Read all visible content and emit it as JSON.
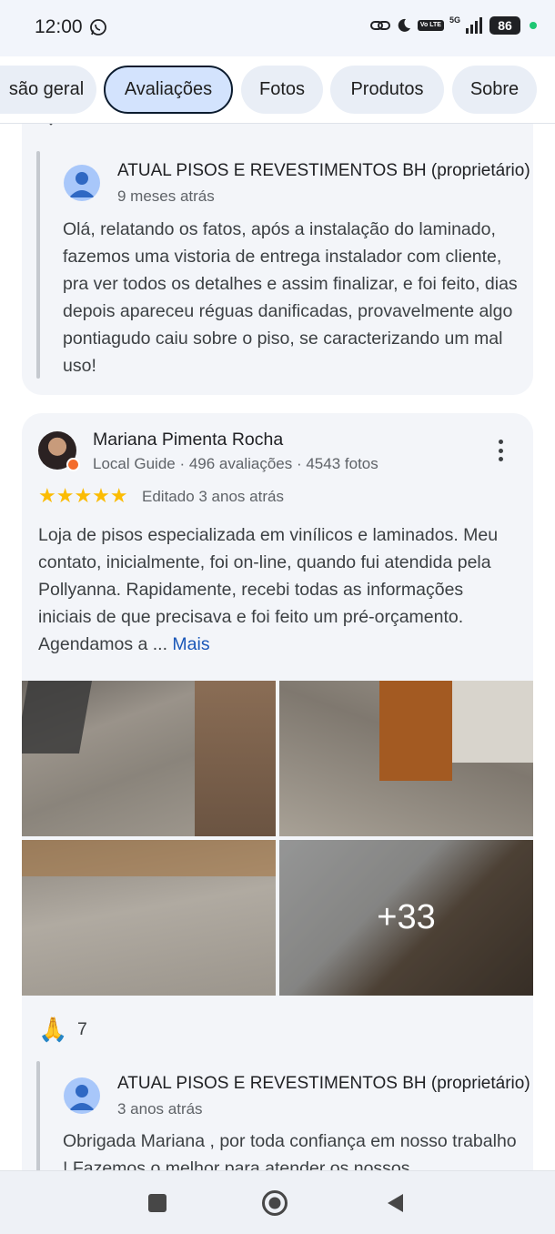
{
  "status": {
    "time": "12:00",
    "network": "5G",
    "volte": "Vo LTE",
    "battery": "86"
  },
  "tabs": [
    {
      "label": "são geral",
      "active": false
    },
    {
      "label": "Avaliações",
      "active": true
    },
    {
      "label": "Fotos",
      "active": false
    },
    {
      "label": "Produtos",
      "active": false
    },
    {
      "label": "Sobre",
      "active": false
    }
  ],
  "replies": [
    {
      "owner_name": "ATUAL PISOS E REVESTIMENTOS BH (proprietário)",
      "time": "9 meses atrás",
      "text": "Olá, relatando os fatos, após a instalação do laminado, fazemos uma vistoria de entrega instalador com cliente, pra ver todos os detalhes e assim finalizar, e foi feito, dias depois apareceu réguas danificadas, provavelmente algo pontiagudo caiu sobre o piso, se caracterizando um mal uso!"
    },
    {
      "owner_name": "ATUAL PISOS E REVESTIMENTOS BH (proprietário)",
      "time": "3 anos atrás",
      "text": "Obrigada Mariana , por toda confiança em nosso trabalho ! Fazemos o melhor para atender os nossos"
    }
  ],
  "review": {
    "name": "Mariana Pimenta Rocha",
    "meta": "Local Guide · 496 avaliações · 4543 fotos",
    "rating": 5,
    "stars": "★★★★★",
    "edited": "Editado 3 anos atrás",
    "text": "Loja de pisos especializada em vinílicos e laminados. Meu contato, inicialmente, foi on-line, quando fui atendida pela Pollyanna. Rapidamente, recebi todas as informações iniciais de que precisava e foi feito um pré-orçamento. Agendamos a ... ",
    "more_label": "Mais",
    "photos_extra": "+33",
    "reaction_icon": "🙏",
    "reaction_count": "7"
  },
  "colors": {
    "accent": "#1a57b8",
    "star": "#fbbc04",
    "card": "#f3f5f9",
    "tab_active": "#d3e3fd"
  }
}
